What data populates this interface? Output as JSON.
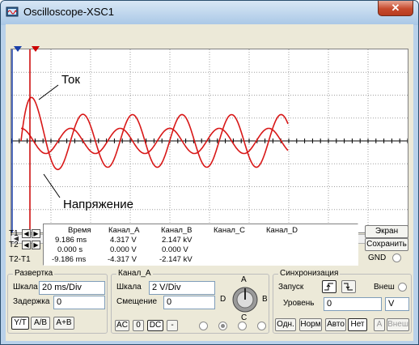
{
  "window": {
    "title": "Oscilloscope-XSC1",
    "close_glyph": "✕"
  },
  "icons": {
    "app": "oscilloscope-icon",
    "close": "close-icon",
    "cursor1": "cursor-t1-marker-icon",
    "cursor2": "cursor-t2-marker-icon"
  },
  "colors": {
    "trace": "#d81818",
    "cursor": "#cc0000",
    "grid": "#a0a0a0"
  },
  "annotations": {
    "current": "Ток",
    "voltage": "Напряжение"
  },
  "measurements": {
    "headers": [
      "Время",
      "Канал_A",
      "Канал_B",
      "Канал_C",
      "Канал_D"
    ],
    "rows": [
      {
        "label": "T1",
        "time": "9.186 ms",
        "a": "4.317 V",
        "b": "2.147 kV",
        "c": "",
        "d": ""
      },
      {
        "label": "T2",
        "time": "0.000 s",
        "a": "0.000 V",
        "b": "0.000 V",
        "c": "",
        "d": ""
      },
      {
        "label": "T2-T1",
        "time": "-9.186 ms",
        "a": "-4.317 V",
        "b": "-2.147 kV",
        "c": "",
        "d": ""
      }
    ]
  },
  "side_buttons": {
    "screen": "Экран",
    "save": "Сохранить",
    "gnd": "GND"
  },
  "timebase": {
    "title": "Развертка",
    "scale_label": "Шкала",
    "scale_value": "20 ms/Div",
    "delay_label": "Задержка",
    "delay_value": "0",
    "modes": [
      "Y/T",
      "A/B",
      "A+B"
    ]
  },
  "channel_a": {
    "title": "Канал_A",
    "scale_label": "Шкала",
    "scale_value": "2  V/Div",
    "offset_label": "Смещение",
    "offset_value": "0",
    "coupling": [
      "AC",
      "0",
      "DC",
      "-"
    ],
    "knob_labels": {
      "top": "A",
      "right": "B",
      "bottom": "C",
      "left": "D"
    }
  },
  "trigger": {
    "title": "Синхронизация",
    "start_label": "Запуск",
    "ext_label": "Внеш",
    "level_label": "Уровень",
    "level_value": "0",
    "level_unit": "V",
    "modes": [
      "Одн.",
      "Норм",
      "Авто",
      "Нет"
    ],
    "a_label": "A",
    "ext_button": "Внеш"
  },
  "chart_data": {
    "type": "line",
    "x_divisions": 10,
    "y_divisions": 8,
    "grid": true,
    "series": [
      {
        "name": "Ток",
        "t0": 0.0,
        "amp0": 3.0,
        "amp_final": 1.15,
        "tau": 0.32,
        "freq_per_div": 0.8,
        "phase": 0.0
      },
      {
        "name": "Напряжение",
        "t0": 0.0,
        "amp0": 0.55,
        "amp_final": 0.55,
        "tau": 1.0,
        "freq_per_div": 0.8,
        "phase": 1.5708
      }
    ]
  }
}
